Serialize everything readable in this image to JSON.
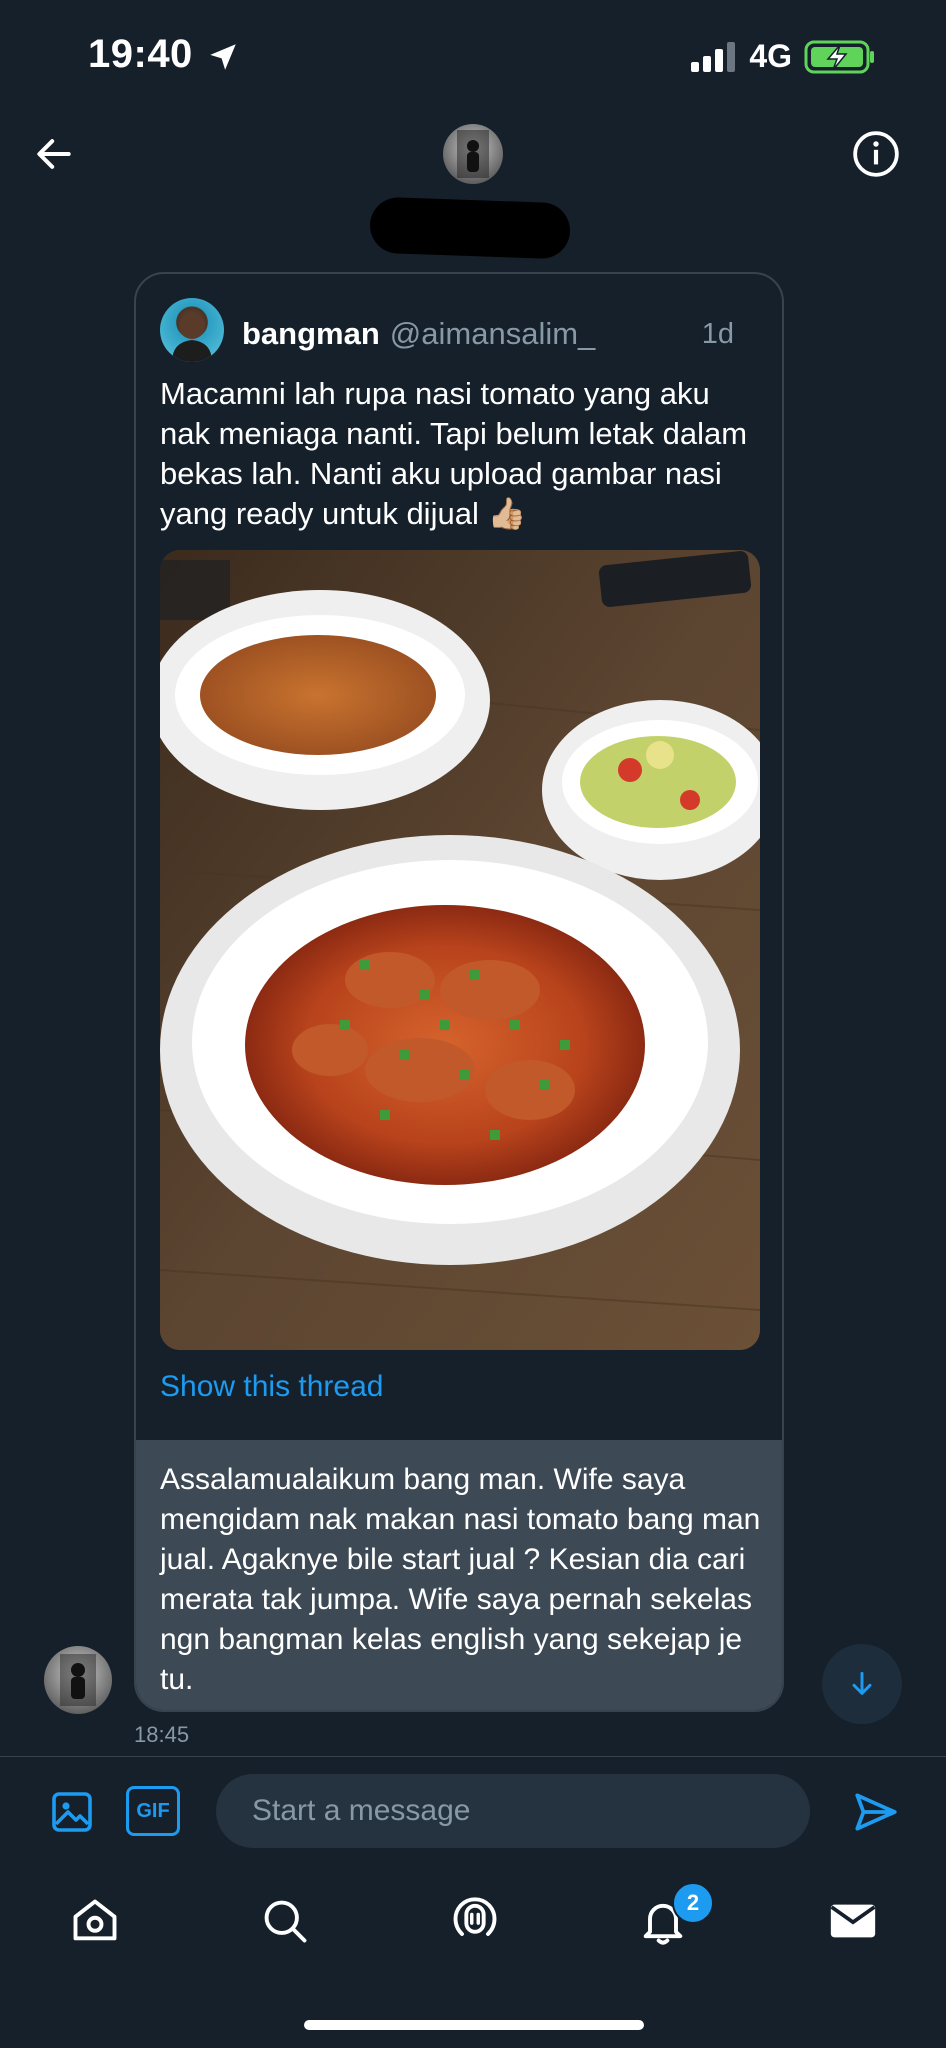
{
  "status_bar": {
    "time": "19:40",
    "network": "4G"
  },
  "header": {
    "back_icon": "arrow-left-icon",
    "info_icon": "info-circle-icon"
  },
  "tweet": {
    "name": "bangman",
    "handle": "@aimansalim_",
    "age": "1d",
    "text": "Macamni lah rupa nasi tomato yang aku nak meniaga nanti. Tapi belum letak dalam bekas lah. Nanti aku upload gambar nasi yang ready untuk dijual 👍🏼",
    "show_thread": "Show this thread"
  },
  "message": {
    "text": "Assalamualaikum bang man. Wife saya mengidam nak makan nasi tomato bang man jual. Agaknye bile start jual ? Kesian dia cari merata tak jumpa. Wife saya pernah sekelas ngn bangman kelas english yang sekejap je tu.",
    "time": "18:45"
  },
  "composer": {
    "gif_label": "GIF",
    "placeholder": "Start a message"
  },
  "bottom_nav": {
    "items": [
      "home-icon",
      "search-icon",
      "spaces-icon",
      "notifications-icon",
      "messages-icon"
    ],
    "notification_count": "2"
  },
  "colors": {
    "background": "#15202b",
    "accent": "#1d9bf0",
    "bubble": "#3d4954",
    "muted": "#8899a6"
  }
}
